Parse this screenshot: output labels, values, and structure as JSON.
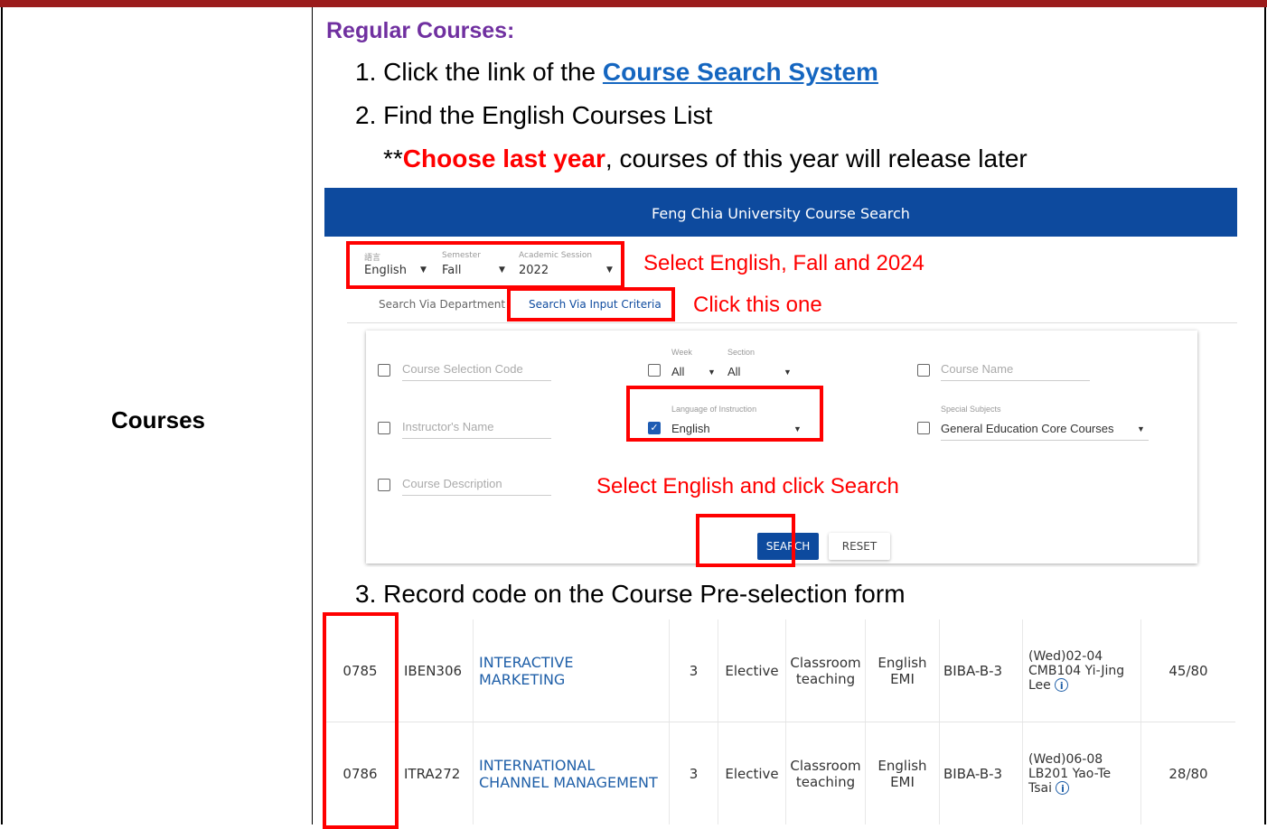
{
  "left_label": "Courses",
  "heading": "Regular Courses:",
  "step1_prefix": "1. Click the link of the ",
  "step1_link": "Course Search System",
  "step2": "2. Find the English Courses List",
  "note_prefix": "**",
  "note_red": "Choose last year",
  "note_rest": ", courses of this year will release later",
  "step3": "3. Record code on the Course Pre-selection form",
  "search_ui": {
    "app_title": "Feng Chia University Course Search",
    "lang_label": "語言",
    "lang_value": "English",
    "semester_label": "Semester",
    "semester_value": "Fall",
    "session_label": "Academic Session",
    "session_value": "2022",
    "tab_department": "Search Via Department",
    "tab_input": "Search Via Input Criteria",
    "annot_select": "Select English, Fall and 2024",
    "annot_click": "Click this one",
    "annot_search": "Select English and click Search",
    "field_code": "Course Selection Code",
    "week_label": "Week",
    "week_value": "All",
    "section_label": "Section",
    "section_value": "All",
    "field_course_name": "Course Name",
    "field_instructor": "Instructor's Name",
    "lang_instr_label": "Language of Instruction",
    "lang_instr_value": "English",
    "special_label": "Special Subjects",
    "special_value": "General Education Core Courses",
    "field_description": "Course Description",
    "search_button": "SEARCH",
    "reset_button": "RESET"
  },
  "courses": [
    {
      "code": "0785",
      "id": "IBEN306",
      "name": "INTERACTIVE MARKETING",
      "credits": "3",
      "type": "Elective",
      "method": "Classroom teaching",
      "language": "English EMI",
      "class": "BIBA-B-3",
      "schedule": "(Wed)02-04 CMB104 Yi-Jing Lee",
      "enrolled": "45/80"
    },
    {
      "code": "0786",
      "id": "ITRA272",
      "name": "INTERNATIONAL CHANNEL MANAGEMENT",
      "credits": "3",
      "type": "Elective",
      "method": "Classroom teaching",
      "language": "English EMI",
      "class": "BIBA-B-3",
      "schedule": "(Wed)06-08 LB201 Yao-Te Tsai",
      "enrolled": "28/80"
    }
  ]
}
